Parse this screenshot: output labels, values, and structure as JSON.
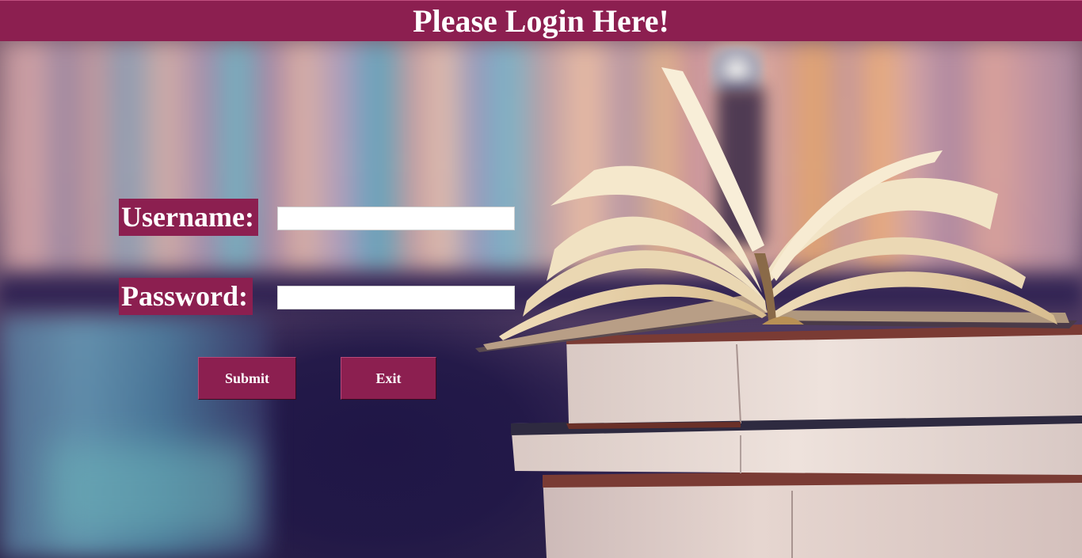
{
  "header": {
    "title": "Please Login Here!"
  },
  "form": {
    "username_label": "Username:",
    "password_label": "Password:",
    "username_value": "",
    "password_value": ""
  },
  "buttons": {
    "submit_label": "Submit",
    "exit_label": "Exit"
  },
  "colors": {
    "accent": "#8c1f50",
    "text": "#ffffff",
    "input_bg": "#ffffff"
  },
  "background": {
    "icon": "open-book-on-stack-icon"
  }
}
